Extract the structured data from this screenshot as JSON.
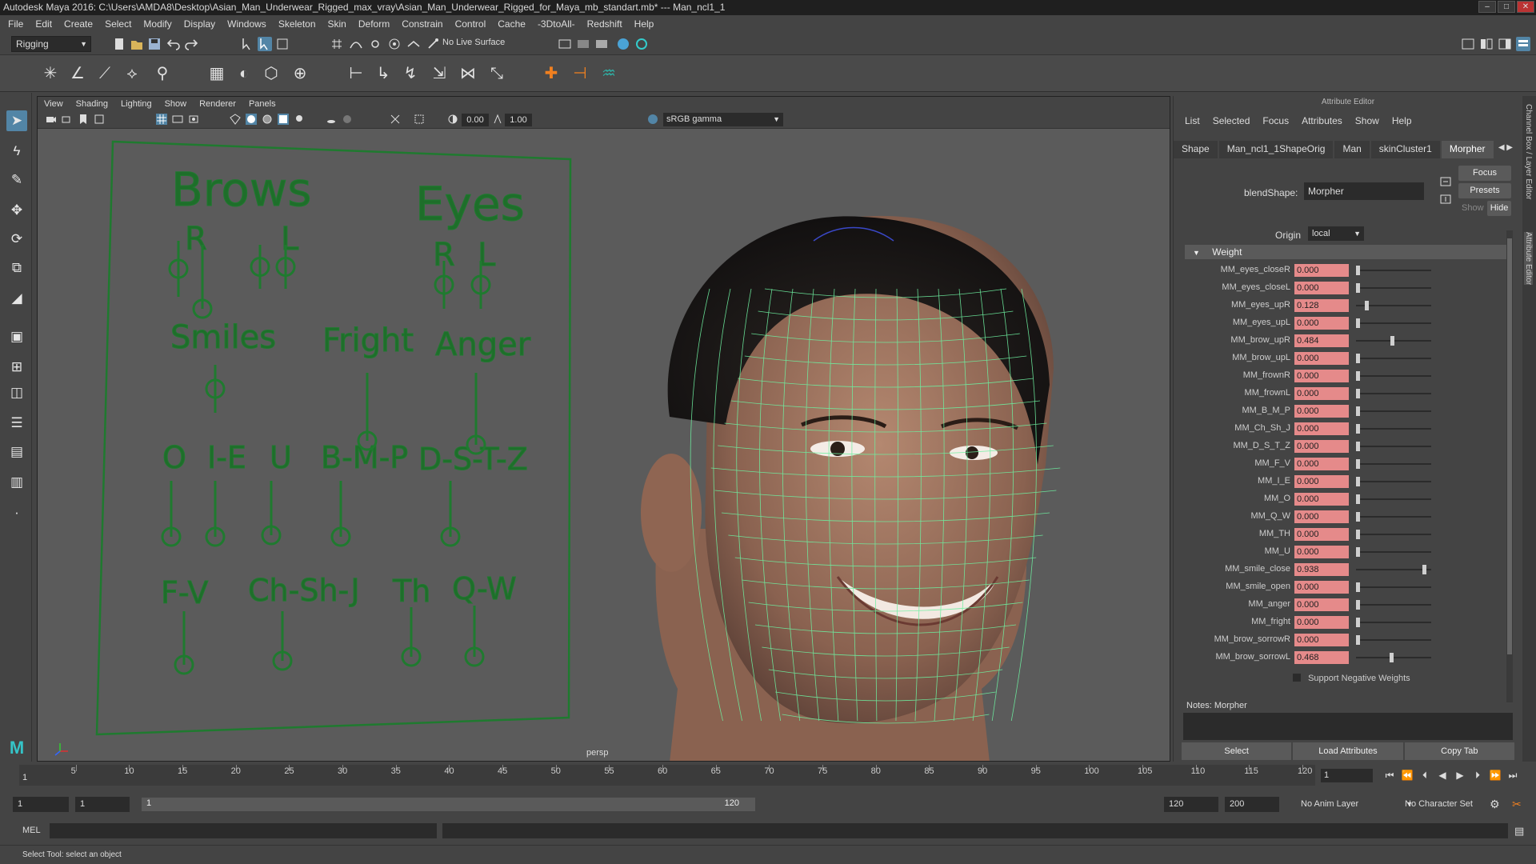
{
  "window": {
    "title": "Autodesk Maya 2016: C:\\Users\\AMDA8\\Desktop\\Asian_Man_Underwear_Rigged_max_vray\\Asian_Man_Underwear_Rigged_for_Maya_mb_standart.mb*   ---   Man_ncl1_1"
  },
  "menubar": [
    "File",
    "Edit",
    "Create",
    "Select",
    "Modify",
    "Display",
    "Windows",
    "Skeleton",
    "Skin",
    "Deform",
    "Constrain",
    "Control",
    "Cache",
    "-3DtoAll-",
    "Redshift",
    "Help"
  ],
  "status_line": {
    "menu_set": "Rigging",
    "live_surface": "No Live Surface"
  },
  "viewport": {
    "menus": [
      "View",
      "Shading",
      "Lighting",
      "Show",
      "Renderer",
      "Panels"
    ],
    "near_value": "0.00",
    "far_value": "1.00",
    "color_space": "sRGB gamma",
    "camera_label": "persp"
  },
  "face_board": {
    "labels": {
      "brows": "Brows",
      "brows_r": "R",
      "brows_l": "L",
      "eyes": "Eyes",
      "eyes_r": "R",
      "eyes_l": "L",
      "smiles": "Smiles",
      "fright": "Fright",
      "anger": "Anger",
      "o": "O",
      "ie": "I-E",
      "u": "U",
      "bmp": "B-M-P",
      "dstz": "D-S-T-Z",
      "fv": "F-V",
      "chshj": "Ch-Sh-J",
      "th": "Th",
      "qw": "Q-W"
    }
  },
  "attribute_editor": {
    "title": "Attribute Editor",
    "menus": [
      "List",
      "Selected",
      "Focus",
      "Attributes",
      "Show",
      "Help"
    ],
    "tabs": [
      "Shape",
      "Man_ncl1_1ShapeOrig",
      "Man",
      "skinCluster1",
      "Morpher"
    ],
    "active_tab": "Morpher",
    "focus_button": "Focus",
    "presets_button": "Presets",
    "show_label": "Show",
    "hide_button": "Hide",
    "blendshape_label": "blendShape:",
    "blendshape_value": "Morpher",
    "origin_label": "Origin",
    "origin_value": "local",
    "weight_section": "Weight",
    "weights": [
      {
        "name": "MM_eyes_closeR",
        "value": "0.000",
        "fraction": 0.0
      },
      {
        "name": "MM_eyes_closeL",
        "value": "0.000",
        "fraction": 0.0
      },
      {
        "name": "MM_eyes_upR",
        "value": "0.128",
        "fraction": 0.128
      },
      {
        "name": "MM_eyes_upL",
        "value": "0.000",
        "fraction": 0.0
      },
      {
        "name": "MM_brow_upR",
        "value": "0.484",
        "fraction": 0.484
      },
      {
        "name": "MM_brow_upL",
        "value": "0.000",
        "fraction": 0.0
      },
      {
        "name": "MM_frownR",
        "value": "0.000",
        "fraction": 0.0
      },
      {
        "name": "MM_frownL",
        "value": "0.000",
        "fraction": 0.0
      },
      {
        "name": "MM_B_M_P",
        "value": "0.000",
        "fraction": 0.0
      },
      {
        "name": "MM_Ch_Sh_J",
        "value": "0.000",
        "fraction": 0.0
      },
      {
        "name": "MM_D_S_T_Z",
        "value": "0.000",
        "fraction": 0.0
      },
      {
        "name": "MM_F_V",
        "value": "0.000",
        "fraction": 0.0
      },
      {
        "name": "MM_I_E",
        "value": "0.000",
        "fraction": 0.0
      },
      {
        "name": "MM_O",
        "value": "0.000",
        "fraction": 0.0
      },
      {
        "name": "MM_Q_W",
        "value": "0.000",
        "fraction": 0.0
      },
      {
        "name": "MM_TH",
        "value": "0.000",
        "fraction": 0.0
      },
      {
        "name": "MM_U",
        "value": "0.000",
        "fraction": 0.0
      },
      {
        "name": "MM_smile_close",
        "value": "0.938",
        "fraction": 0.938
      },
      {
        "name": "MM_smile_open",
        "value": "0.000",
        "fraction": 0.0
      },
      {
        "name": "MM_anger",
        "value": "0.000",
        "fraction": 0.0
      },
      {
        "name": "MM_fright",
        "value": "0.000",
        "fraction": 0.0
      },
      {
        "name": "MM_brow_sorrowR",
        "value": "0.000",
        "fraction": 0.0
      },
      {
        "name": "MM_brow_sorrowL",
        "value": "0.468",
        "fraction": 0.468
      }
    ],
    "support_negative": "Support Negative Weights",
    "notes_label": "Notes:  Morpher",
    "bottom_buttons": [
      "Select",
      "Load Attributes",
      "Copy Tab"
    ]
  },
  "side_tabs": [
    "Channel Box / Layer Editor",
    "Attribute Editor"
  ],
  "time_slider": {
    "ticks": [
      "5",
      "10",
      "15",
      "20",
      "25",
      "30",
      "35",
      "40",
      "45",
      "50",
      "55",
      "60",
      "65",
      "70",
      "75",
      "80",
      "85",
      "90",
      "95",
      "100",
      "105",
      "110",
      "115",
      "120"
    ],
    "current_cursor": "1",
    "current_frame": "1"
  },
  "range_slider": {
    "start_field": "1",
    "start_playback": "1",
    "bar_start": "1",
    "bar_end": "120",
    "end_playback": "120",
    "end_field": "200",
    "anim_layer": "No Anim Layer",
    "character_set": "No Character Set"
  },
  "command_line": {
    "label": "MEL"
  },
  "help_line": "Select Tool: select an object",
  "colors": {
    "accent": "#5285a6",
    "keyed_field": "#e58a8a",
    "board_green": "#1f7a2f",
    "wire_green": "#6ef0a0"
  }
}
